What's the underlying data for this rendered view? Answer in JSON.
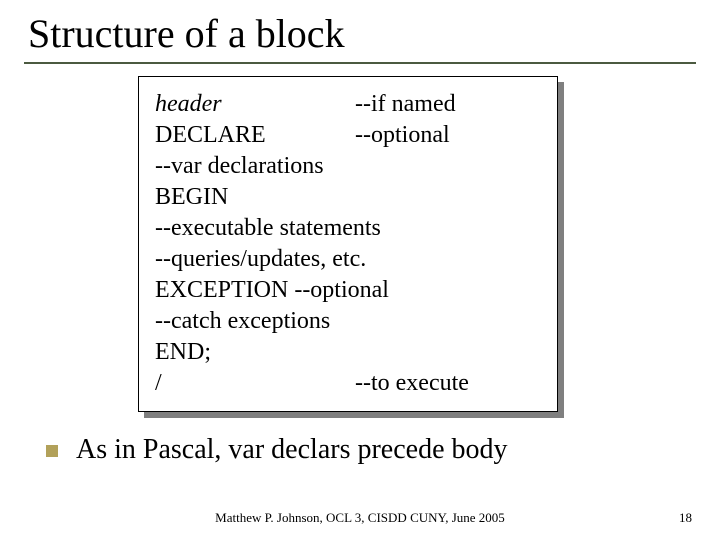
{
  "title": "Structure of a block",
  "code": {
    "r1l": "header",
    "r1r": "--if named",
    "r2l": "DECLARE",
    "r2r": "--optional",
    "r3": "--var declarations",
    "r4": "BEGIN",
    "r5": "--executable statements",
    "r6": "--queries/updates, etc.",
    "r7": "EXCEPTION --optional",
    "r8": "--catch exceptions",
    "r9": "END;",
    "r10l": "/",
    "r10r": "--to execute"
  },
  "bullet": "As in Pascal, var declars precede body",
  "footer": "Matthew P. Johnson, OCL 3, CISDD CUNY, June 2005",
  "page": "18"
}
